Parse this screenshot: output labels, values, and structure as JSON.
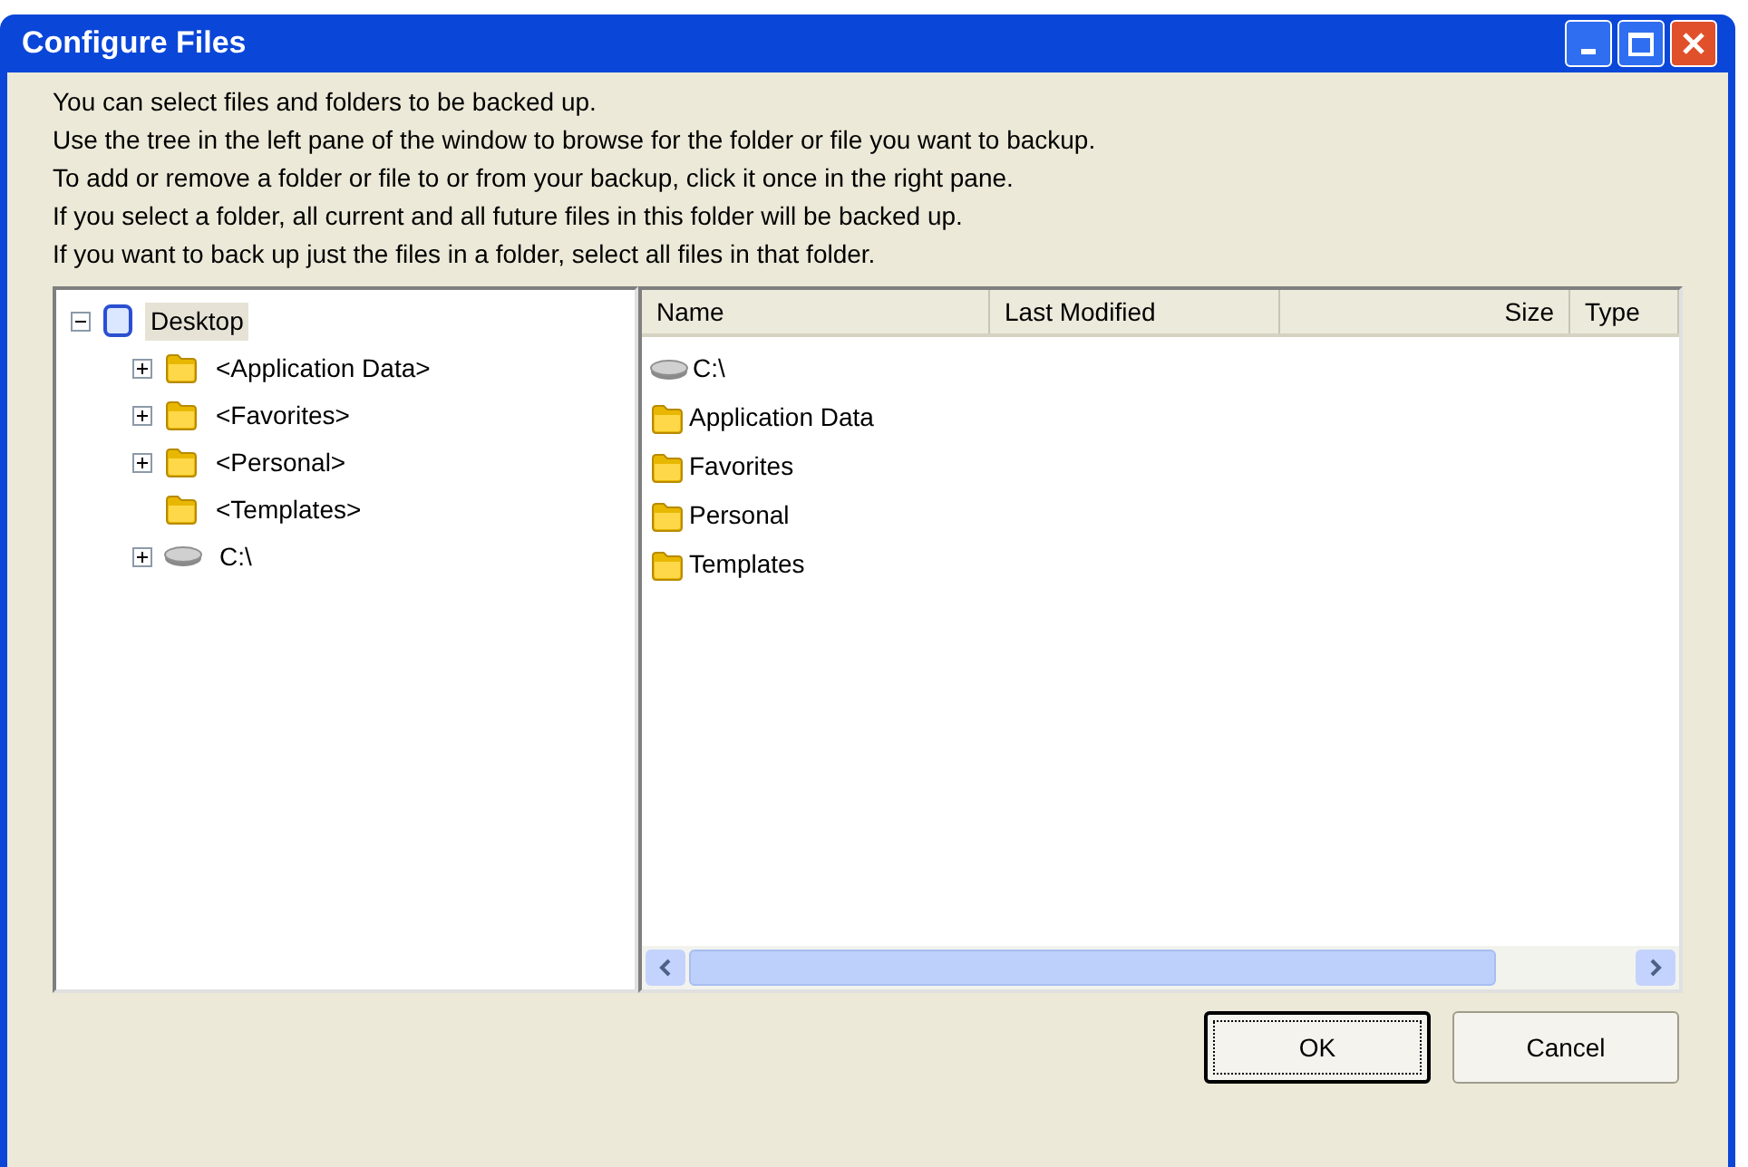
{
  "window": {
    "title": "Configure Files"
  },
  "instructions": [
    "You can select files and folders to be backed up.",
    "Use the tree in the left pane of the window to browse for the folder or file you want to backup.",
    "To add or remove a folder or file to or from your backup, click it once in the right pane.",
    "If you select a folder, all current and all future files in this folder will be backed up.",
    "If you want to back up just the files in a folder, select all files in that folder."
  ],
  "tree": [
    {
      "label": "Desktop",
      "kind": "desktop",
      "selected": true,
      "expanded": true,
      "children": [
        {
          "label": "<Application Data>",
          "kind": "folder",
          "selected": false,
          "expanded": false
        },
        {
          "label": "<Favorites>",
          "kind": "folder",
          "selected": false,
          "expanded": false
        },
        {
          "label": "<Personal>",
          "kind": "folder",
          "selected": false,
          "expanded": false
        },
        {
          "label": "<Templates>",
          "kind": "folder",
          "selected": false
        },
        {
          "label": "C:\\",
          "kind": "drive",
          "selected": false,
          "expanded": false
        }
      ]
    }
  ],
  "list": {
    "columns": [
      "Name",
      "Last Modified",
      "Size",
      "Type"
    ],
    "rows": [
      {
        "name": "C:\\",
        "kind": "drive"
      },
      {
        "name": "Application Data",
        "kind": "folder"
      },
      {
        "name": "Favorites",
        "kind": "folder"
      },
      {
        "name": "Personal",
        "kind": "folder"
      },
      {
        "name": "Templates",
        "kind": "folder"
      }
    ]
  },
  "buttons": [
    {
      "label": "OK",
      "default": true
    },
    {
      "label": "Cancel",
      "default": false
    }
  ]
}
